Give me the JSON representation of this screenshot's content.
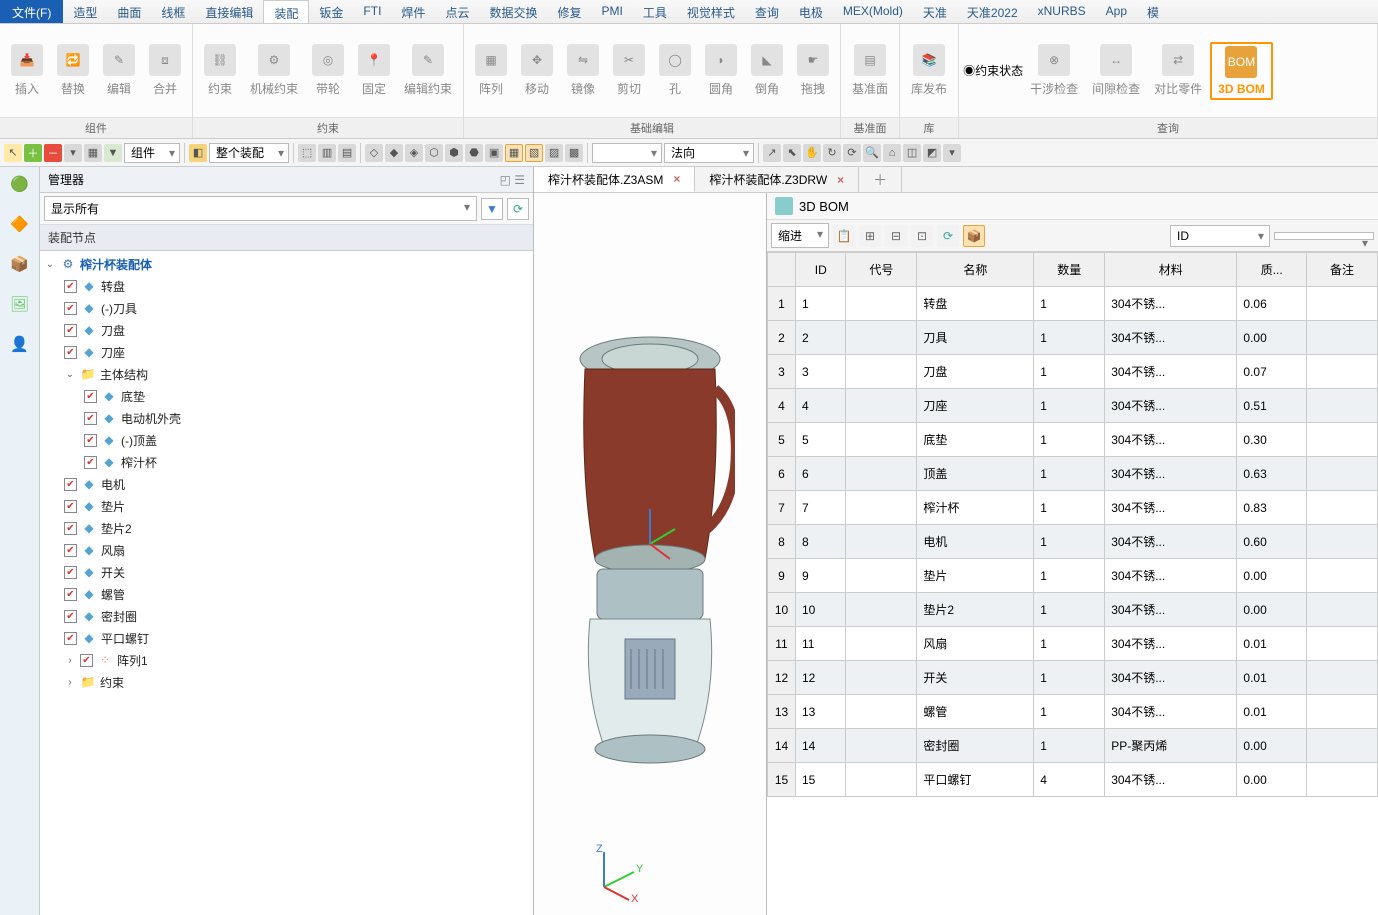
{
  "menu": {
    "file": "文件(F)",
    "items": [
      "造型",
      "曲面",
      "线框",
      "直接编辑",
      "装配",
      "钣金",
      "FTI",
      "焊件",
      "点云",
      "数据交换",
      "修复",
      "PMI",
      "工具",
      "视觉样式",
      "查询",
      "电极",
      "MEX(Mold)",
      "天准",
      "天准2022",
      "xNURBS",
      "App",
      "模"
    ]
  },
  "ribbon_groups": {
    "g1": {
      "title": "组件",
      "items": [
        "插入",
        "替换",
        "编辑",
        "合并"
      ]
    },
    "g2": {
      "title": "约束",
      "items": [
        "约束",
        "机械约束",
        "带轮",
        "固定",
        "编辑约束"
      ]
    },
    "g3": {
      "title": "基础编辑",
      "items": [
        "阵列",
        "移动",
        "镜像",
        "剪切",
        "孔",
        "圆角",
        "倒角",
        "拖拽"
      ]
    },
    "g4": {
      "title": "基准面",
      "items": [
        "基准面"
      ]
    },
    "g5": {
      "title": "库",
      "items": [
        "库发布"
      ]
    },
    "g6": {
      "title": "查询",
      "items": [
        "约束状态",
        "干涉检查",
        "间隙检查",
        "对比零件",
        "3D BOM"
      ]
    }
  },
  "toolbar2": {
    "combo1": "组件",
    "combo2": "整个装配",
    "combo3": "",
    "combo4": "法向"
  },
  "manager": {
    "title": "管理器",
    "filter_label": "显示所有",
    "tree_header": "装配节点",
    "root": "榨汁杯装配体",
    "nodes": {
      "n1": "转盘",
      "n2": "(-)刀具",
      "n3": "刀盘",
      "n4": "刀座",
      "grp": "主体结构",
      "g1": "底垫",
      "g2": "电动机外壳",
      "g3": "(-)顶盖",
      "g4": "榨汁杯",
      "n5": "电机",
      "n6": "垫片",
      "n7": "垫片2",
      "n8": "风扇",
      "n9": "开关",
      "n10": "螺管",
      "n11": "密封圈",
      "n12": "平口螺钉",
      "pat": "阵列1",
      "con": "约束"
    }
  },
  "tabs": {
    "t1": "榨汁杯装配体.Z3ASM",
    "t2": "榨汁杯装配体.Z3DRW"
  },
  "bom": {
    "title": "3D BOM",
    "mode": "缩进",
    "id_sel": "ID",
    "cols": [
      "ID",
      "代号",
      "名称",
      "数量",
      "材料",
      "质...",
      "备注"
    ]
  },
  "chart_data": {
    "type": "table",
    "columns": [
      "ID",
      "代号",
      "名称",
      "数量",
      "材料",
      "质量",
      "备注"
    ],
    "rows": [
      {
        "id": "1",
        "code": "",
        "name": "转盘",
        "qty": "1",
        "material": "304不锈...",
        "mass": "0.06",
        "note": ""
      },
      {
        "id": "2",
        "code": "",
        "name": "刀具",
        "qty": "1",
        "material": "304不锈...",
        "mass": "0.00",
        "note": ""
      },
      {
        "id": "3",
        "code": "",
        "name": "刀盘",
        "qty": "1",
        "material": "304不锈...",
        "mass": "0.07",
        "note": ""
      },
      {
        "id": "4",
        "code": "",
        "name": "刀座",
        "qty": "1",
        "material": "304不锈...",
        "mass": "0.51",
        "note": ""
      },
      {
        "id": "5",
        "code": "",
        "name": "底垫",
        "qty": "1",
        "material": "304不锈...",
        "mass": "0.30",
        "note": ""
      },
      {
        "id": "6",
        "code": "",
        "name": "顶盖",
        "qty": "1",
        "material": "304不锈...",
        "mass": "0.63",
        "note": ""
      },
      {
        "id": "7",
        "code": "",
        "name": "榨汁杯",
        "qty": "1",
        "material": "304不锈...",
        "mass": "0.83",
        "note": ""
      },
      {
        "id": "8",
        "code": "",
        "name": "电机",
        "qty": "1",
        "material": "304不锈...",
        "mass": "0.60",
        "note": ""
      },
      {
        "id": "9",
        "code": "",
        "name": "垫片",
        "qty": "1",
        "material": "304不锈...",
        "mass": "0.00",
        "note": ""
      },
      {
        "id": "10",
        "code": "",
        "name": "垫片2",
        "qty": "1",
        "material": "304不锈...",
        "mass": "0.00",
        "note": ""
      },
      {
        "id": "11",
        "code": "",
        "name": "风扇",
        "qty": "1",
        "material": "304不锈...",
        "mass": "0.01",
        "note": ""
      },
      {
        "id": "12",
        "code": "",
        "name": "开关",
        "qty": "1",
        "material": "304不锈...",
        "mass": "0.01",
        "note": ""
      },
      {
        "id": "13",
        "code": "",
        "name": "螺管",
        "qty": "1",
        "material": "304不锈...",
        "mass": "0.01",
        "note": ""
      },
      {
        "id": "14",
        "code": "",
        "name": "密封圈",
        "qty": "1",
        "material": "PP-聚丙烯",
        "mass": "0.00",
        "note": ""
      },
      {
        "id": "15",
        "code": "",
        "name": "平口螺钉",
        "qty": "4",
        "material": "304不锈...",
        "mass": "0.00",
        "note": ""
      }
    ]
  },
  "triad": {
    "x": "X",
    "y": "Y",
    "z": "Z"
  }
}
